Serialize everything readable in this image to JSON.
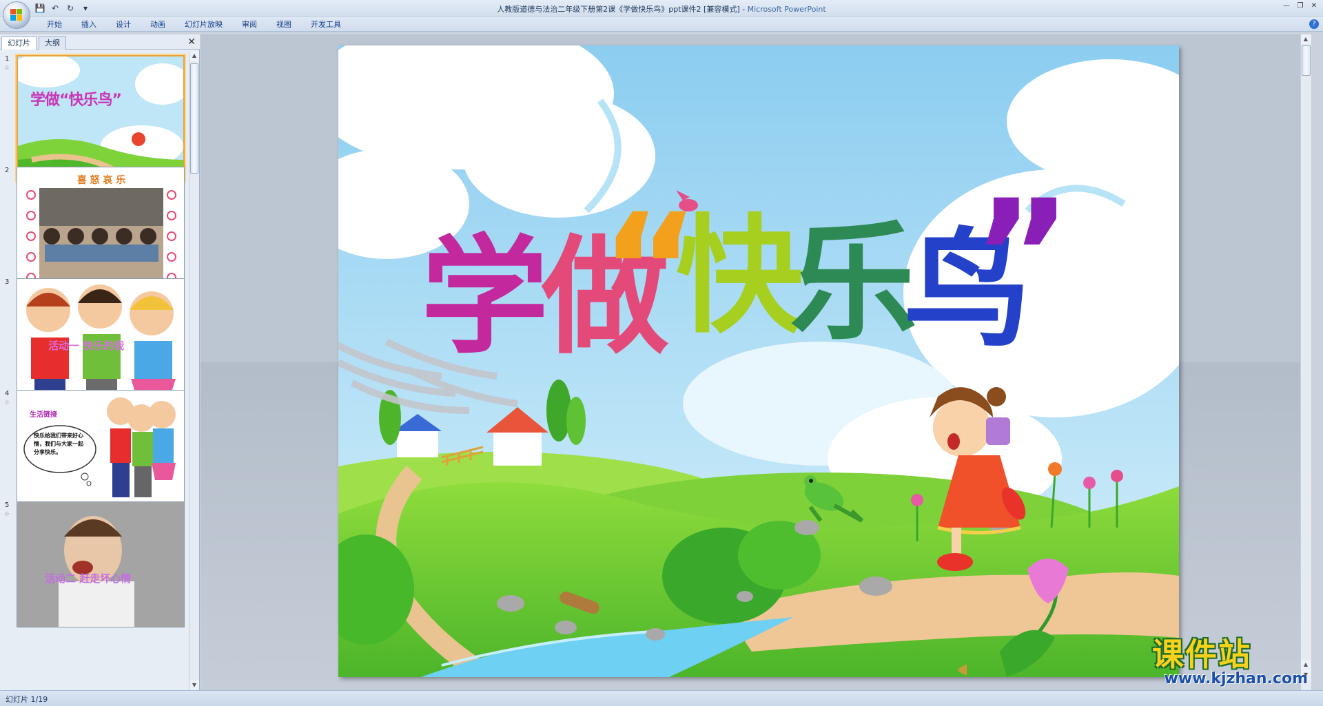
{
  "window": {
    "title": "人教版道德与法治二年级下册第2课《学做快乐鸟》ppt课件2 [兼容模式]",
    "separator": " - ",
    "app_name": "Microsoft PowerPoint"
  },
  "ribbon": {
    "tabs": [
      "开始",
      "插入",
      "设计",
      "动画",
      "幻灯片放映",
      "审阅",
      "视图",
      "开发工具"
    ]
  },
  "panel": {
    "tab_slides": "幻灯片",
    "tab_outline": "大纲",
    "thumbnails": [
      {
        "num": "1",
        "text": "学做“快乐鸟”"
      },
      {
        "num": "2",
        "text": "喜 怒 哀 乐"
      },
      {
        "num": "3",
        "text": "活动一 快乐的我"
      },
      {
        "num": "4",
        "text": "生活链接",
        "body": "快乐给我们带来好心情，我们与大家一起分享快乐。"
      },
      {
        "num": "5",
        "text": "活动二 赶走坏心情"
      }
    ]
  },
  "slide": {
    "title_chars": [
      "学",
      "做",
      "“",
      "快",
      "乐",
      "鸟",
      "”"
    ]
  },
  "watermark": {
    "cn": "课件站",
    "url": "www.kjzhan.com"
  },
  "status": {
    "text": "幻灯片 1/19"
  }
}
